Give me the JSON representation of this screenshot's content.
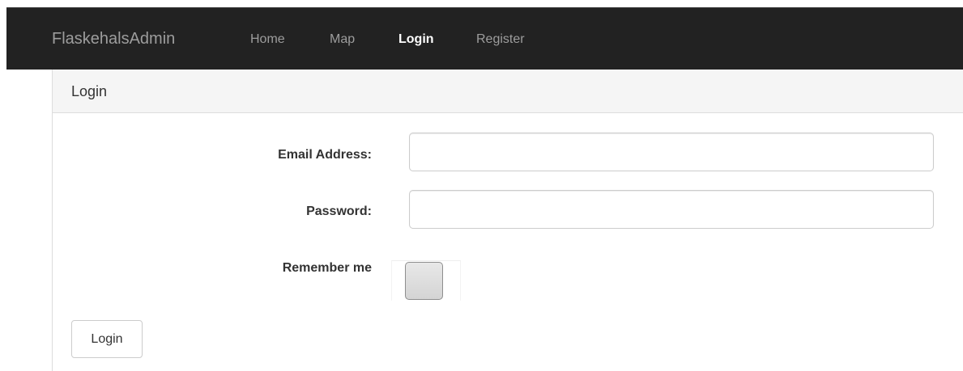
{
  "navbar": {
    "brand": "FlaskehalsAdmin",
    "links": [
      {
        "label": "Home",
        "active": false
      },
      {
        "label": "Map",
        "active": false
      },
      {
        "label": "Login",
        "active": true
      },
      {
        "label": "Register",
        "active": false
      }
    ]
  },
  "panel": {
    "title": "Login"
  },
  "form": {
    "email_label": "Email Address:",
    "email_value": "",
    "password_label": "Password:",
    "password_value": "",
    "remember_label": "Remember me",
    "remember_checked": false,
    "submit_label": "Login"
  },
  "colors": {
    "navbar_bg": "#222222",
    "nav_text": "#9d9d9d",
    "nav_active_text": "#ffffff",
    "panel_heading_bg": "#f5f5f5"
  }
}
